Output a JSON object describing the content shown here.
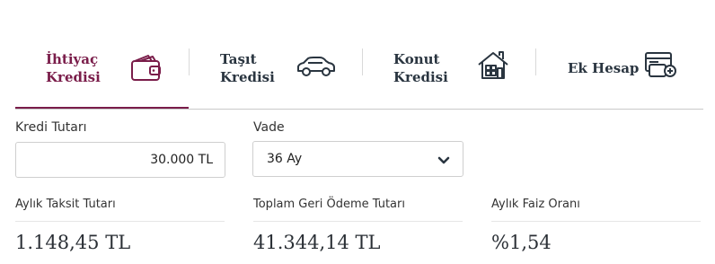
{
  "tabs": [
    {
      "label": "İhtiyaç\nKredisi",
      "icon": "wallet-icon",
      "active": true
    },
    {
      "label": "Taşıt\nKredisi",
      "icon": "car-icon",
      "active": false
    },
    {
      "label": "Konut\nKredisi",
      "icon": "house-icon",
      "active": false
    },
    {
      "label": "Ek Hesap",
      "icon": "card-icon",
      "active": false
    }
  ],
  "colors": {
    "accent": "#7a1d4a",
    "text": "#2a3540"
  },
  "form": {
    "amount_label": "Kredi Tutarı",
    "amount_value": "30.000 TL",
    "term_label": "Vade",
    "term_value": "36 Ay"
  },
  "results": {
    "monthly_installment_label": "Aylık Taksit Tutarı",
    "monthly_installment_value": "1.148,45 TL",
    "total_repayment_label": "Toplam Geri Ödeme Tutarı",
    "total_repayment_value": "41.344,14 TL",
    "monthly_rate_label": "Aylık Faiz Oranı",
    "monthly_rate_value": "%1,54"
  }
}
